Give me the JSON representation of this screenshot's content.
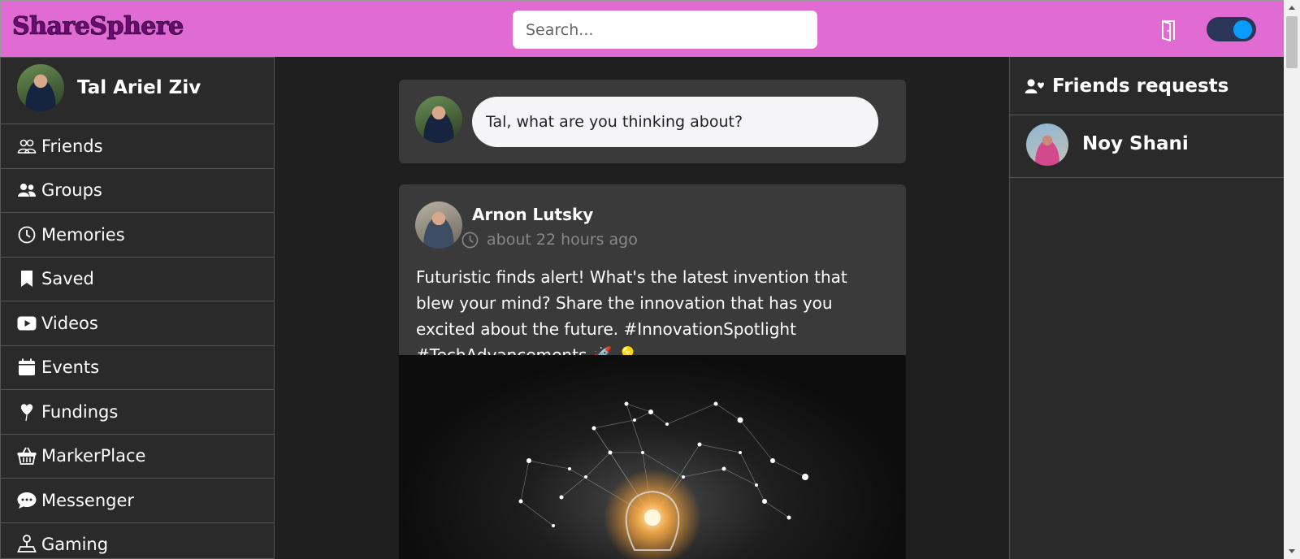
{
  "header": {
    "logo": "ShareSphere",
    "search_placeholder": "Search...",
    "logout_icon": "door-exit-icon",
    "theme_toggle": "on"
  },
  "user": {
    "name": "Tal Ariel Ziv"
  },
  "sidebar": {
    "items": [
      {
        "label": "Friends",
        "icon": "friends-icon"
      },
      {
        "label": "Groups",
        "icon": "groups-icon"
      },
      {
        "label": "Memories",
        "icon": "clock-icon"
      },
      {
        "label": "Saved",
        "icon": "bookmark-icon"
      },
      {
        "label": "Videos",
        "icon": "video-icon"
      },
      {
        "label": "Events",
        "icon": "calendar-icon"
      },
      {
        "label": "Fundings",
        "icon": "heart-balloon-icon"
      },
      {
        "label": "MarkerPlace",
        "icon": "basket-icon"
      },
      {
        "label": "Messenger",
        "icon": "chat-icon"
      },
      {
        "label": "Gaming",
        "icon": "joystick-icon"
      }
    ]
  },
  "composer": {
    "placeholder": "Tal, what are you thinking about?"
  },
  "post": {
    "author": "Arnon Lutsky",
    "time": "about 22 hours ago",
    "text": "Futuristic finds alert! What's the latest invention that blew your mind? Share the innovation that has you excited about the future. #InnovationSpotlight #TechAdvancements 🚀 💡",
    "image": "lightbulb-network-image"
  },
  "friend_requests": {
    "title": "Friends requests",
    "items": [
      {
        "name": "Noy Shani"
      }
    ]
  }
}
